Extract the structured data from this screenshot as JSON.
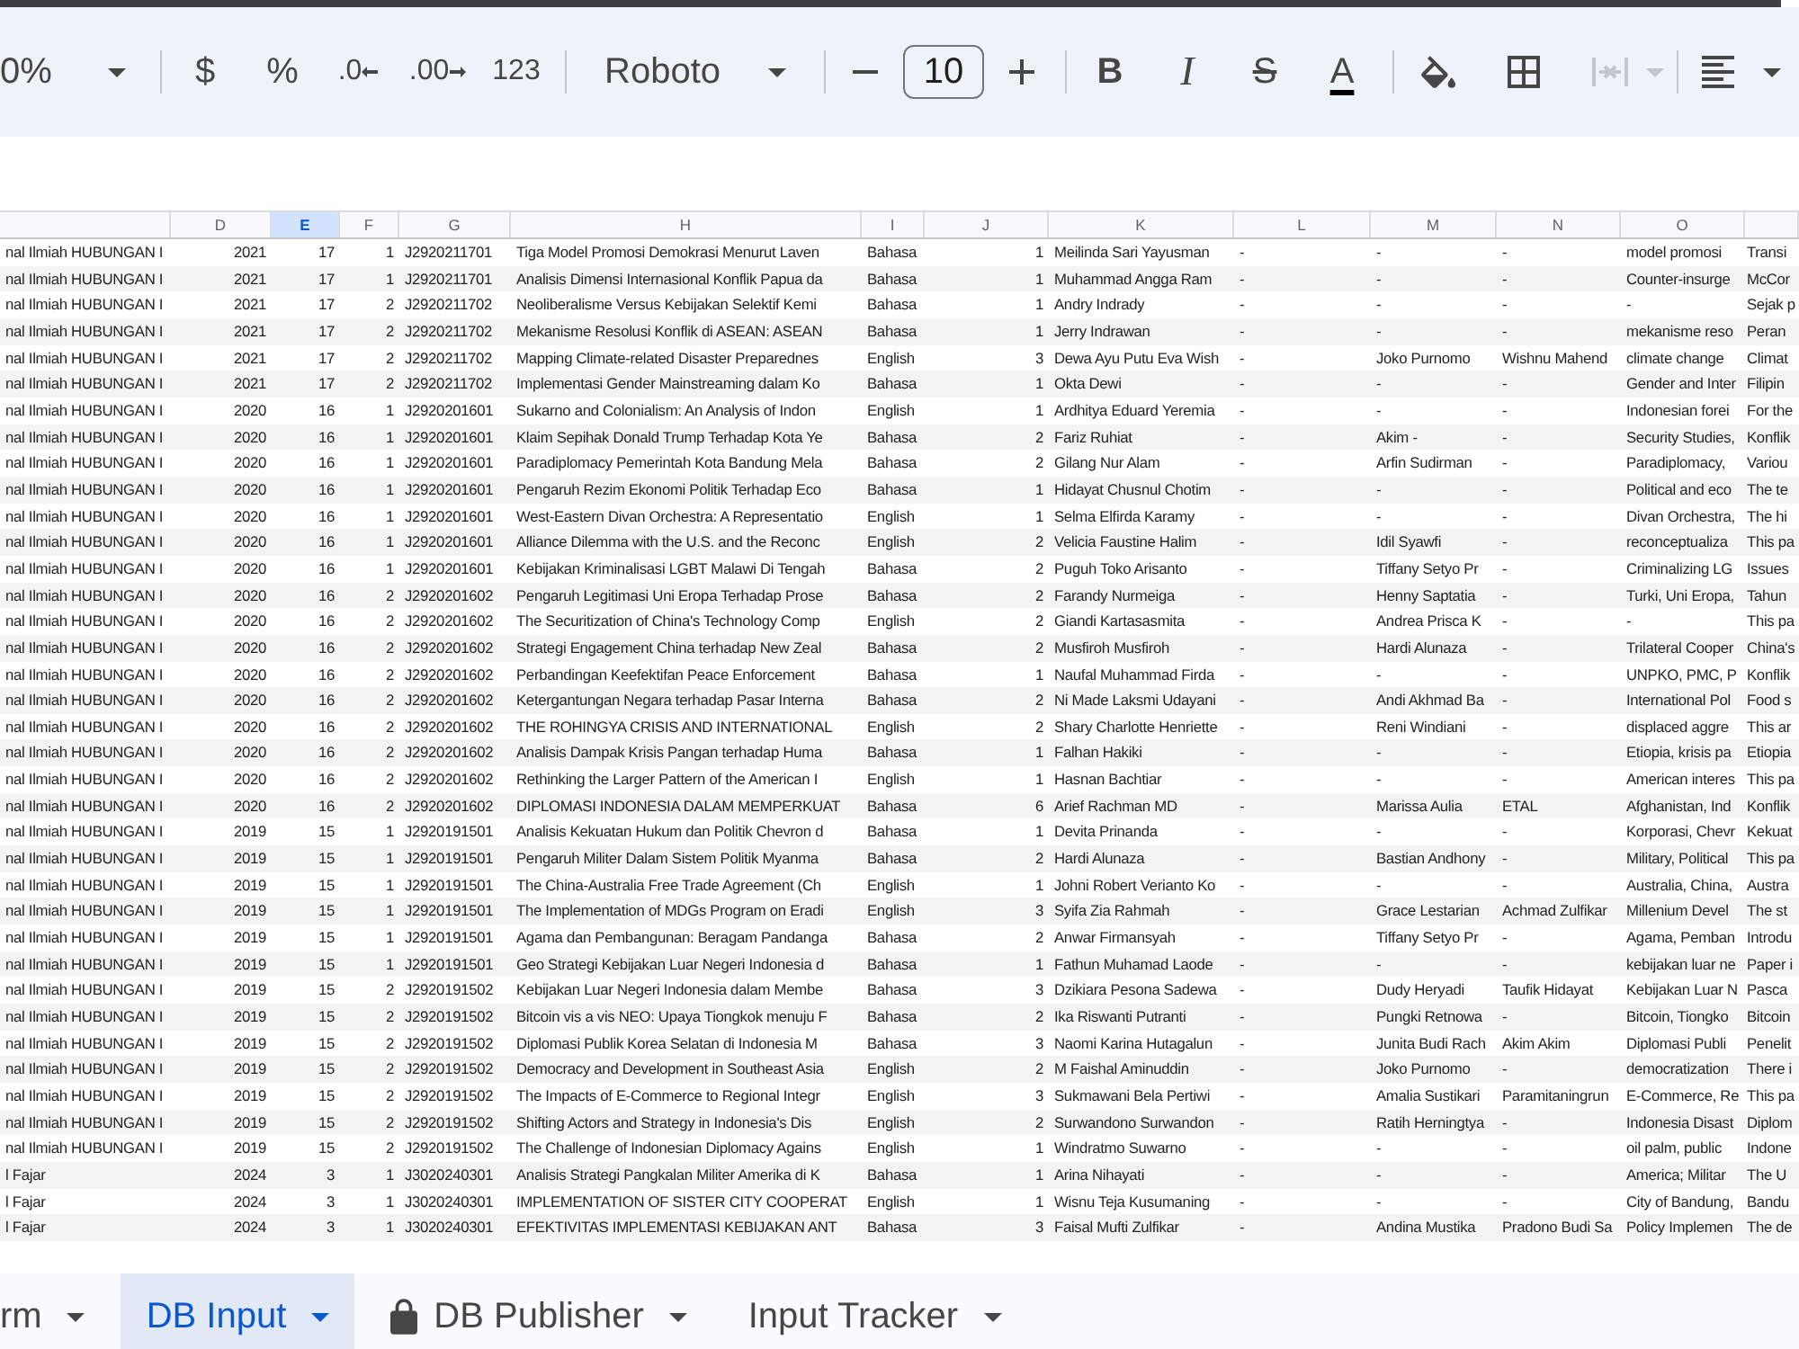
{
  "toolbar": {
    "zoom": "0%",
    "currency": "$",
    "percent": "%",
    "decrease_decimals": ".0",
    "increase_decimals": ".00",
    "number_format": "123",
    "font": "Roboto",
    "font_size": "10",
    "text_styles": [
      {
        "kind": "bold",
        "label": "B"
      },
      {
        "kind": "italic",
        "label": "I"
      },
      {
        "kind": "strikethrough",
        "label": "S"
      },
      {
        "kind": "text-color",
        "label": "A"
      }
    ],
    "merge_cells": {
      "disabled": true
    }
  },
  "sheet": {
    "columns": [
      {
        "selected": false
      },
      {
        "label": "D",
        "selected": false
      },
      {
        "label": "E",
        "selected": true
      },
      {
        "label": "F",
        "selected": false
      },
      {
        "label": "G",
        "selected": false
      },
      {
        "label": "H",
        "selected": false
      },
      {
        "label": "I",
        "selected": false
      },
      {
        "label": "J",
        "selected": false
      },
      {
        "label": "K",
        "selected": false
      },
      {
        "label": "L",
        "selected": false
      },
      {
        "label": "M",
        "selected": false
      },
      {
        "label": "N",
        "selected": false
      },
      {
        "label": "O",
        "selected": false
      },
      {
        "selected": false
      }
    ],
    "rows": [
      [
        "nal Ilmiah HUBUNGAN I",
        "2021",
        "17",
        "1",
        "J2920211701",
        "Tiga Model Promosi Demokrasi Menurut Laven",
        "Bahasa",
        "1",
        "Meilinda Sari Yayusman",
        "-",
        "-",
        "-",
        "model promosi",
        "Transi"
      ],
      [
        "nal Ilmiah HUBUNGAN I",
        "2021",
        "17",
        "1",
        "J2920211701",
        "Analisis Dimensi Internasional Konflik Papua da",
        "Bahasa",
        "1",
        "Muhammad Angga Ram",
        "-",
        "-",
        "-",
        "Counter-insurge",
        "McCor"
      ],
      [
        "nal Ilmiah HUBUNGAN I",
        "2021",
        "17",
        "2",
        "J2920211702",
        "Neoliberalisme Versus Kebijakan Selektif Kemi",
        "Bahasa",
        "1",
        "Andry Indrady",
        "-",
        "-",
        "-",
        "-",
        "Sejak p"
      ],
      [
        "nal Ilmiah HUBUNGAN I",
        "2021",
        "17",
        "2",
        "J2920211702",
        "Mekanisme Resolusi Konflik di ASEAN: ASEAN",
        "Bahasa",
        "1",
        "Jerry Indrawan",
        "-",
        "-",
        "-",
        "mekanisme reso",
        "Peran"
      ],
      [
        "nal Ilmiah HUBUNGAN I",
        "2021",
        "17",
        "2",
        "J2920211702",
        "Mapping Climate-related Disaster Preparednes",
        "English",
        "3",
        "Dewa Ayu Putu Eva Wish",
        "-",
        "Joko Purnomo",
        "Wishnu Mahend",
        "climate change",
        "Climat"
      ],
      [
        "nal Ilmiah HUBUNGAN I",
        "2021",
        "17",
        "2",
        "J2920211702",
        "Implementasi Gender Mainstreaming dalam Ko",
        "Bahasa",
        "1",
        "Okta Dewi",
        "-",
        "-",
        "-",
        "Gender and Inter",
        "Filipin"
      ],
      [
        "nal Ilmiah HUBUNGAN I",
        "2020",
        "16",
        "1",
        "J2920201601",
        "Sukarno and Colonialism: An Analysis of Indon",
        "English",
        "1",
        "Ardhitya Eduard Yeremia",
        "-",
        "-",
        "-",
        "Indonesian forei",
        "For the"
      ],
      [
        "nal Ilmiah HUBUNGAN I",
        "2020",
        "16",
        "1",
        "J2920201601",
        "Klaim Sepihak Donald Trump Terhadap Kota Ye",
        "Bahasa",
        "2",
        "Fariz Ruhiat",
        "-",
        "Akim -",
        "-",
        "Security Studies,",
        "Konflik"
      ],
      [
        "nal Ilmiah HUBUNGAN I",
        "2020",
        "16",
        "1",
        "J2920201601",
        "Paradiplomacy Pemerintah Kota Bandung Mela",
        "Bahasa",
        "2",
        "Gilang Nur Alam",
        "-",
        "Arfin Sudirman",
        "-",
        "Paradiplomacy,",
        "Variou"
      ],
      [
        "nal Ilmiah HUBUNGAN I",
        "2020",
        "16",
        "1",
        "J2920201601",
        "Pengaruh Rezim Ekonomi Politik Terhadap Eco",
        "Bahasa",
        "1",
        "Hidayat Chusnul Chotim",
        "-",
        "-",
        "-",
        "Political and eco",
        "The te"
      ],
      [
        "nal Ilmiah HUBUNGAN I",
        "2020",
        "16",
        "1",
        "J2920201601",
        "West-Eastern Divan Orchestra: A Representatio",
        "English",
        "1",
        "Selma Elfirda Karamy",
        "-",
        "-",
        "-",
        "Divan Orchestra,",
        "The hi"
      ],
      [
        "nal Ilmiah HUBUNGAN I",
        "2020",
        "16",
        "1",
        "J2920201601",
        "Alliance Dilemma with the U.S. and the Reconc",
        "English",
        "2",
        "Velicia Faustine Halim",
        "-",
        "Idil Syawfi",
        "-",
        "reconceptualiza",
        "This pa"
      ],
      [
        "nal Ilmiah HUBUNGAN I",
        "2020",
        "16",
        "1",
        "J2920201601",
        "Kebijakan Kriminalisasi LGBT Malawi Di Tengah",
        "Bahasa",
        "2",
        "Puguh Toko Arisanto",
        "-",
        "Tiffany Setyo Pr",
        "-",
        "Criminalizing LG",
        "Issues"
      ],
      [
        "nal Ilmiah HUBUNGAN I",
        "2020",
        "16",
        "2",
        "J2920201602",
        "Pengaruh Legitimasi Uni Eropa Terhadap Prose",
        "Bahasa",
        "2",
        "Farandy Nurmeiga",
        "-",
        "Henny Saptatia",
        "-",
        "Turki, Uni Eropa,",
        "Tahun"
      ],
      [
        "nal Ilmiah HUBUNGAN I",
        "2020",
        "16",
        "2",
        "J2920201602",
        "The Securitization of China's Technology Comp",
        "English",
        "2",
        "Giandi Kartasasmita",
        "-",
        "Andrea Prisca K",
        "-",
        "-",
        "This pa"
      ],
      [
        "nal Ilmiah HUBUNGAN I",
        "2020",
        "16",
        "2",
        "J2920201602",
        "Strategi Engagement China terhadap New Zeal",
        "Bahasa",
        "2",
        "Musfiroh Musfiroh",
        "-",
        "Hardi Alunaza",
        "-",
        "Trilateral Cooper",
        "China's"
      ],
      [
        "nal Ilmiah HUBUNGAN I",
        "2020",
        "16",
        "2",
        "J2920201602",
        "Perbandingan Keefektifan Peace Enforcement",
        "Bahasa",
        "1",
        "Naufal Muhammad Firda",
        "-",
        "-",
        "-",
        "UNPKO, PMC, P",
        "Konflik"
      ],
      [
        "nal Ilmiah HUBUNGAN I",
        "2020",
        "16",
        "2",
        "J2920201602",
        "Ketergantungan Negara terhadap Pasar Interna",
        "Bahasa",
        "2",
        "Ni Made Laksmi Udayani",
        "-",
        "Andi Akhmad Ba",
        "-",
        "International Pol",
        "Food s"
      ],
      [
        "nal Ilmiah HUBUNGAN I",
        "2020",
        "16",
        "2",
        "J2920201602",
        "THE ROHINGYA CRISIS AND INTERNATIONAL",
        "English",
        "2",
        "Shary Charlotte Henriette",
        "-",
        "Reni Windiani",
        "-",
        "displaced aggre",
        "This ar"
      ],
      [
        "nal Ilmiah HUBUNGAN I",
        "2020",
        "16",
        "2",
        "J2920201602",
        "Analisis Dampak Krisis Pangan terhadap Huma",
        "Bahasa",
        "1",
        "Falhan Hakiki",
        "-",
        "-",
        "-",
        "Etiopia, krisis pa",
        "Etiopia"
      ],
      [
        "nal Ilmiah HUBUNGAN I",
        "2020",
        "16",
        "2",
        "J2920201602",
        "Rethinking the Larger Pattern of the American I",
        "English",
        "1",
        "Hasnan Bachtiar",
        "-",
        "-",
        "-",
        "American interes",
        "This pa"
      ],
      [
        "nal Ilmiah HUBUNGAN I",
        "2020",
        "16",
        "2",
        "J2920201602",
        "DIPLOMASI INDONESIA DALAM MEMPERKUAT",
        "Bahasa",
        "6",
        "Arief Rachman MD",
        "-",
        "Marissa Aulia",
        "ETAL",
        "Afghanistan, Ind",
        "Konflik"
      ],
      [
        "nal Ilmiah HUBUNGAN I",
        "2019",
        "15",
        "1",
        "J2920191501",
        "Analisis Kekuatan Hukum dan Politik Chevron d",
        "Bahasa",
        "1",
        "Devita Prinanda",
        "-",
        "-",
        "-",
        "Korporasi, Chevr",
        "Kekuat"
      ],
      [
        "nal Ilmiah HUBUNGAN I",
        "2019",
        "15",
        "1",
        "J2920191501",
        "Pengaruh Militer Dalam Sistem Politik Myanma",
        "Bahasa",
        "2",
        "Hardi Alunaza",
        "-",
        "Bastian Andhony",
        "-",
        "Military, Political",
        "This pa"
      ],
      [
        "nal Ilmiah HUBUNGAN I",
        "2019",
        "15",
        "1",
        "J2920191501",
        "The China-Australia Free Trade Agreement (Ch",
        "English",
        "1",
        "Johni Robert Verianto Ko",
        "-",
        "-",
        "-",
        "Australia, China,",
        "Austra"
      ],
      [
        "nal Ilmiah HUBUNGAN I",
        "2019",
        "15",
        "1",
        "J2920191501",
        "The Implementation of MDGs Program on Eradi",
        "English",
        "3",
        "Syifa Zia Rahmah",
        "-",
        "Grace Lestarian",
        "Achmad Zulfikar",
        "Millenium Devel",
        "The st"
      ],
      [
        "nal Ilmiah HUBUNGAN I",
        "2019",
        "15",
        "1",
        "J2920191501",
        "Agama dan Pembangunan: Beragam Pandanga",
        "Bahasa",
        "2",
        "Anwar Firmansyah",
        "-",
        "Tiffany Setyo Pr",
        "-",
        "Agama, Pemban",
        "Introdu"
      ],
      [
        "nal Ilmiah HUBUNGAN I",
        "2019",
        "15",
        "1",
        "J2920191501",
        "Geo Strategi Kebijakan Luar Negeri Indonesia d",
        "Bahasa",
        "1",
        "Fathun Muhamad Laode",
        "-",
        "-",
        "-",
        "kebijakan luar ne",
        "Paper i"
      ],
      [
        "nal Ilmiah HUBUNGAN I",
        "2019",
        "15",
        "2",
        "J2920191502",
        "Kebijakan Luar Negeri Indonesia dalam Membe",
        "Bahasa",
        "3",
        "Dzikiara Pesona Sadewa",
        "-",
        "Dudy Heryadi",
        "Taufik Hidayat",
        "Kebijakan Luar N",
        "Pasca"
      ],
      [
        "nal Ilmiah HUBUNGAN I",
        "2019",
        "15",
        "2",
        "J2920191502",
        "Bitcoin vis a vis NEO: Upaya Tiongkok menuju F",
        "Bahasa",
        "2",
        "Ika Riswanti Putranti",
        "-",
        "Pungki Retnowa",
        "-",
        "Bitcoin, Tiongko",
        "Bitcoin"
      ],
      [
        "nal Ilmiah HUBUNGAN I",
        "2019",
        "15",
        "2",
        "J2920191502",
        "Diplomasi Publik Korea Selatan di Indonesia M",
        "Bahasa",
        "3",
        "Naomi Karina Hutagalun",
        "-",
        "Junita Budi Rach",
        "Akim Akim",
        "Diplomasi Publi",
        "Penelit"
      ],
      [
        "nal Ilmiah HUBUNGAN I",
        "2019",
        "15",
        "2",
        "J2920191502",
        "Democracy and Development in Southeast Asia",
        "English",
        "2",
        "M Faishal Aminuddin",
        "-",
        "Joko Purnomo",
        "-",
        "democratization",
        "There i"
      ],
      [
        "nal Ilmiah HUBUNGAN I",
        "2019",
        "15",
        "2",
        "J2920191502",
        "The Impacts of E-Commerce to Regional Integr",
        "English",
        "3",
        "Sukmawani Bela Pertiwi",
        "-",
        "Amalia Sustikari",
        "Paramitaningrun",
        "E-Commerce, Re",
        "This pa"
      ],
      [
        "nal Ilmiah HUBUNGAN I",
        "2019",
        "15",
        "2",
        "J2920191502",
        "Shifting Actors and Strategy in Indonesia's Dis",
        "English",
        "2",
        "Surwandono Surwandon",
        "-",
        "Ratih Herningtya",
        "-",
        "Indonesia Disast",
        "Diplom"
      ],
      [
        "nal Ilmiah HUBUNGAN I",
        "2019",
        "15",
        "2",
        "J2920191502",
        "The Challenge of Indonesian Diplomacy Agains",
        "English",
        "1",
        "Windratmo Suwarno",
        "-",
        "-",
        "-",
        "oil palm, public",
        "Indone"
      ],
      [
        "l Fajar",
        "2024",
        "3",
        "1",
        "J3020240301",
        "Analisis Strategi Pangkalan Militer Amerika di K",
        "Bahasa",
        "1",
        "Arina Nihayati",
        "-",
        "-",
        "-",
        "America; Militar",
        "The U"
      ],
      [
        "l Fajar",
        "2024",
        "3",
        "1",
        "J3020240301",
        "IMPLEMENTATION OF SISTER CITY COOPERAT",
        "English",
        "1",
        "Wisnu Teja Kusumaning",
        "-",
        "-",
        "-",
        "City of Bandung,",
        "Bandu"
      ],
      [
        "l Fajar",
        "2024",
        "3",
        "1",
        "J3020240301",
        "EFEKTIVITAS IMPLEMENTASI KEBIJAKAN ANT",
        "Bahasa",
        "3",
        "Faisal Mufti Zulfikar",
        "-",
        "Andina Mustika",
        "Pradono Budi Sa",
        "Policy Implemen",
        "The de"
      ]
    ]
  },
  "sheet_tabs": [
    {
      "label": "rm",
      "selected": false,
      "locked": false
    },
    {
      "label": "DB Input",
      "selected": true,
      "locked": false
    },
    {
      "label": "DB Publisher",
      "selected": false,
      "locked": true
    },
    {
      "label": "Input Tracker",
      "selected": false,
      "locked": false
    }
  ]
}
